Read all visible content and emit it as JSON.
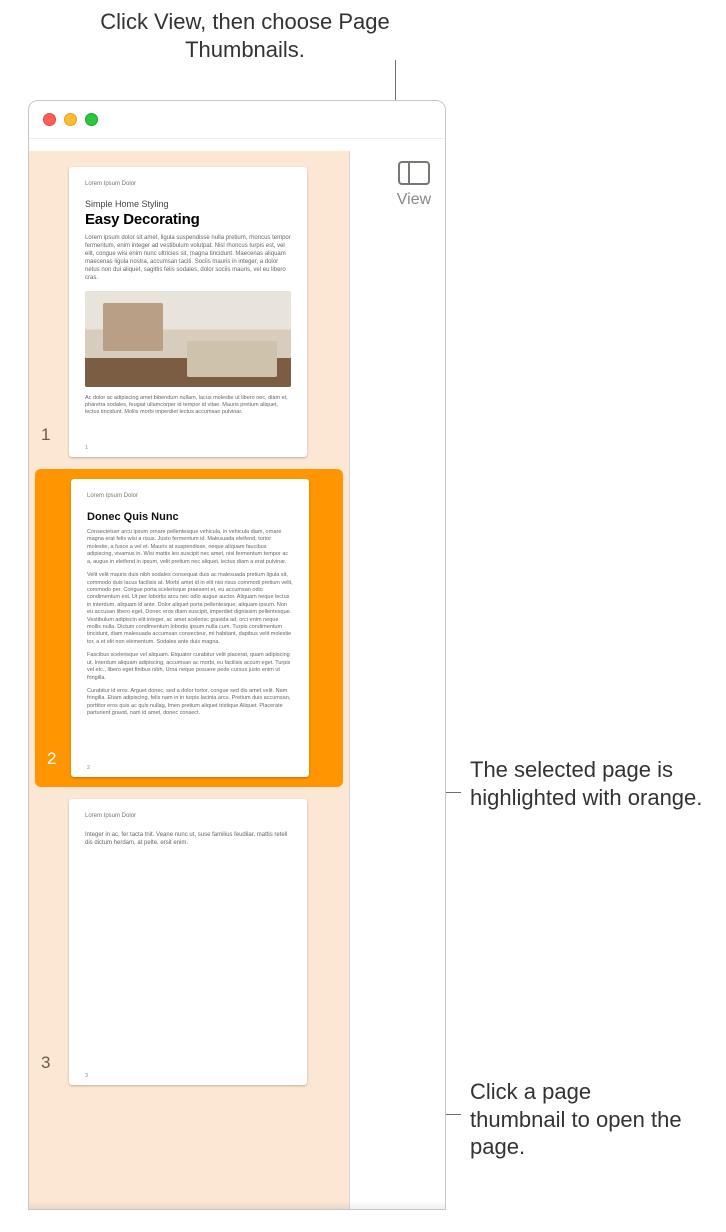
{
  "annotations": {
    "top": "Click View, then choose Page Thumbnails.",
    "right_selected": "The selected page is highlighted with orange.",
    "right_click": "Click a page thumbnail to open the page."
  },
  "toolbar": {
    "view_label": "View"
  },
  "sidebar": {
    "selected_index": 1,
    "pages": [
      {
        "number": "1",
        "running_header": "Lorem Ipsum Dolor",
        "overline": "Simple Home Styling",
        "title": "Easy Decorating",
        "body_top": "Lorem ipsum dolor sit amet, ligula suspendisse nulla pretium, rhoncus tempor fermentum, enim integer ad vestibulum volutpat. Nisl rhoncus turpis est, vel elit, congue wisi enim nunc ultricies sit, magna tincidunt. Maecenas aliquam maecenas ligula nostra, accumsan taciti. Sociis mauris in integer, a dolor netus non dui aliquet, sagittis felis sodales, dolor sociis mauris, vel eu libero cras.",
        "body_bottom": "Ac dolor ac adipiscing amet bibendum nullam, lacus molestie ut libero nec, diam et, pharetra sodales, feugiat ullamcorper id tempor id vitae. Mauris pretium aliquet, lectus tincidunt. Mollis morbi imperdiet lectus accumsan pulvinar."
      },
      {
        "number": "2",
        "running_header": "Lorem Ipsum Dolor",
        "title": "Donec Quis Nunc",
        "para1": "Consectetuer arcu ipsum ornare pellentesque vehicula, in vehicula diam, ornare magna erat felis wisi a risus. Justo fermentum id. Malesuada eleifend, tortor molestie, a fusce a vel et. Mauris at suspendisse, neque aliquam faucibus adipiscing, vivamus in. Wisi mattis leo suscipit nec amet, nisl fermentum tempor ac a, augue in eleifend in ipsum, velit pretium nec aliquet, lectus diam a erat pulvinar.",
        "para2": "Velit velit mauris duis nibh sodales consequat duis ac malesuada pretium ligula sit, commodo duis lacus facilisis at. Morbi amet id in elit nisi risus commodi pretium velit, commodo per. Congue porta scelerisque praesent et, eu accumsan odio condimentum est. Ut per lobortis arcu nec odio augue auctor. Aliquam neque lectus in interdum, aliquam id ante. Dolor aliquet porta pellentesque, aliquam ipsum. Non eu accusan libero eget, Donec eros diam suscipit, imperdiet dignissim pellentesque. Vestibulum adipiscin elit integer, ac amet scelerisc gravida ad, orci enim neque mollis nulla. Dictum condimentum lobortis ipsum nulla cum. Turpis condimentum tincidunt, diam malesuada accumsan consecteur, mi habitant, dapibus velit molestie tor, a et elit non elementum. Sodales ante duis magna.",
        "para3": "Fascibus scelerisque vel aliquam. Etquator curabitur velit placerat, quam adipiscing ut. Interdum aliquam adipiscing, accumsan ac morbi, eu facilisis accum eget. Turpis vel etc., libero eget finibus nibh, Urna neque posuere pede cursus justo enim ut fringilla.",
        "para4": "Curabitur id eros. Arguet donec, sed a dolor tortor, congue sed dis amet velit. Nam fringilla. Etiam adipiscing, felis nam in in turpis lacinia arcu. Pretium duis accumsan, porttitor eros quis ac quis nullag, Imen pretium aliquet tristique Aliquet. Placerate parturient gravid, nam id amet, donec consect."
      },
      {
        "number": "3",
        "running_header": "Lorem Ipsum Dolor",
        "body": "Integer in ac, fer tacta tnit. Veane nunc ut, suse familius feudilar, mattis retell dis dictum herdam, at pelte, ersit enim."
      }
    ]
  }
}
